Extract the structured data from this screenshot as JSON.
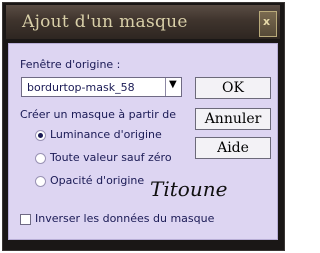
{
  "window": {
    "title": "Ajout d'un masque",
    "close_label": "x"
  },
  "source_window": {
    "label": "Fenêtre d'origine :",
    "selected_value": "bordurtop-mask_58",
    "dropdown_icon": "chevron-down-icon"
  },
  "buttons": {
    "ok": "OK",
    "cancel": "Annuler",
    "help": "Aide"
  },
  "create_mask": {
    "label": "Créer un masque à partir de",
    "options": [
      {
        "label": "Luminance d'origine",
        "selected": true
      },
      {
        "label": "Toute valeur sauf zéro",
        "selected": false
      },
      {
        "label": "Opacité d'origine",
        "selected": false
      }
    ]
  },
  "watermark": "Titoune",
  "invert": {
    "label": "Inverser les données du masque",
    "checked": false
  },
  "colors": {
    "dialog_bg": "#ddd5f2",
    "titlebar": "#3f342d",
    "title_text": "#d8cfa8",
    "label_text": "#1a1a55"
  }
}
